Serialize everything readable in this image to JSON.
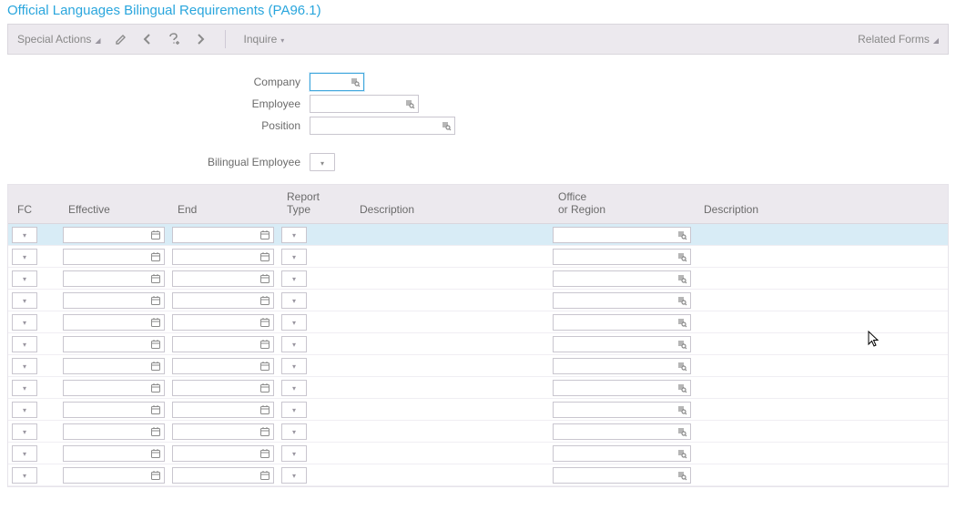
{
  "title": "Official Languages Bilingual Requirements (PA96.1)",
  "toolbar": {
    "special_actions": "Special Actions",
    "inquire": "Inquire",
    "related_forms": "Related Forms"
  },
  "form": {
    "company_label": "Company",
    "company_value": "",
    "employee_label": "Employee",
    "employee_value": "",
    "position_label": "Position",
    "position_value": "",
    "bilingual_label": "Bilingual Employee",
    "bilingual_value": ""
  },
  "grid": {
    "headers": {
      "fc": "FC",
      "effective": "Effective",
      "end": "End",
      "report_top": "Report",
      "report_bot": "Type",
      "description": "Description",
      "office_top": "Office",
      "office_bot": "or Region",
      "description2": "Description"
    },
    "row_count": 12,
    "selected_row": 0
  }
}
